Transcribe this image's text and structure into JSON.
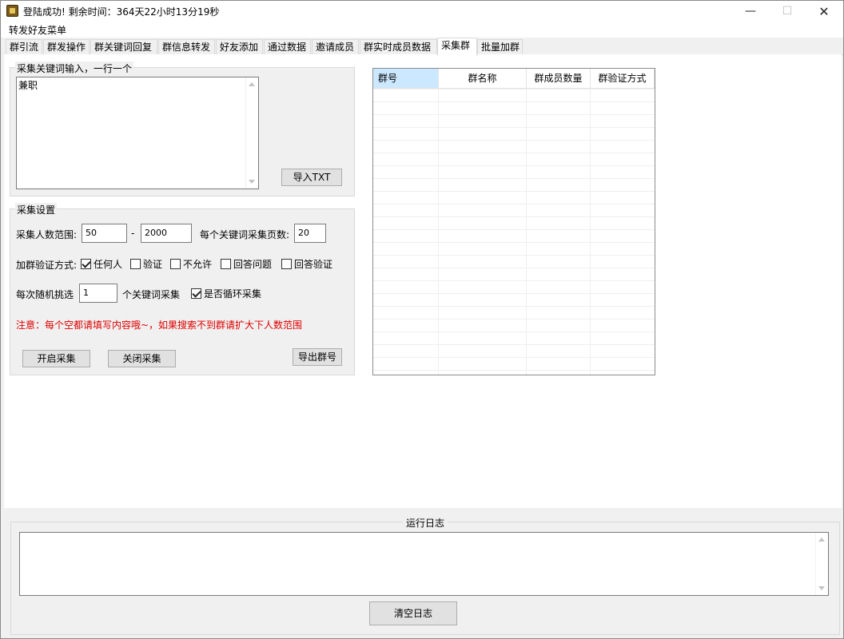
{
  "window": {
    "title": "登陆成功! 剩余时间：364天22小时13分19秒",
    "minimize": "—",
    "maximize": "☐",
    "close": "✕"
  },
  "menu": {
    "item": "转发好友菜单"
  },
  "tabs": [
    {
      "label": "群引流"
    },
    {
      "label": "群发操作"
    },
    {
      "label": "群关键词回复"
    },
    {
      "label": "群信息转发"
    },
    {
      "label": "好友添加"
    },
    {
      "label": "通过数据"
    },
    {
      "label": "邀请成员"
    },
    {
      "label": "群实时成员数据"
    },
    {
      "label": "采集群",
      "active": true
    },
    {
      "label": "批量加群"
    }
  ],
  "keywords": {
    "group_title": "采集关键词输入，一行一个",
    "value": "兼职",
    "import_button": "导入TXT"
  },
  "settings": {
    "group_title": "采集设置",
    "range_label": "采集人数范围:",
    "range_min": "50",
    "range_sep": "-",
    "range_max": "2000",
    "pages_label": "每个关键词采集页数:",
    "pages_value": "20",
    "verify_label": "加群验证方式:",
    "verify_options": [
      {
        "label": "任何人",
        "checked": true
      },
      {
        "label": "验证",
        "checked": false
      },
      {
        "label": "不允许",
        "checked": false
      },
      {
        "label": "回答问题",
        "checked": false
      },
      {
        "label": "回答验证",
        "checked": false
      }
    ],
    "random_label": "每次随机挑选",
    "random_value": "1",
    "random_suffix": "个关键词采集",
    "loop_label": "是否循环采集",
    "loop_checked": true,
    "warning": "注意：每个空都请填写内容哦~，如果搜索不到群请扩大下人数范围",
    "start_button": "开启采集",
    "stop_button": "关闭采集",
    "export_button": "导出群号"
  },
  "grid": {
    "columns": [
      "群号",
      "群名称",
      "群成员数量",
      "群验证方式"
    ],
    "rows": []
  },
  "log": {
    "title": "运行日志",
    "clear_button": "清空日志"
  }
}
